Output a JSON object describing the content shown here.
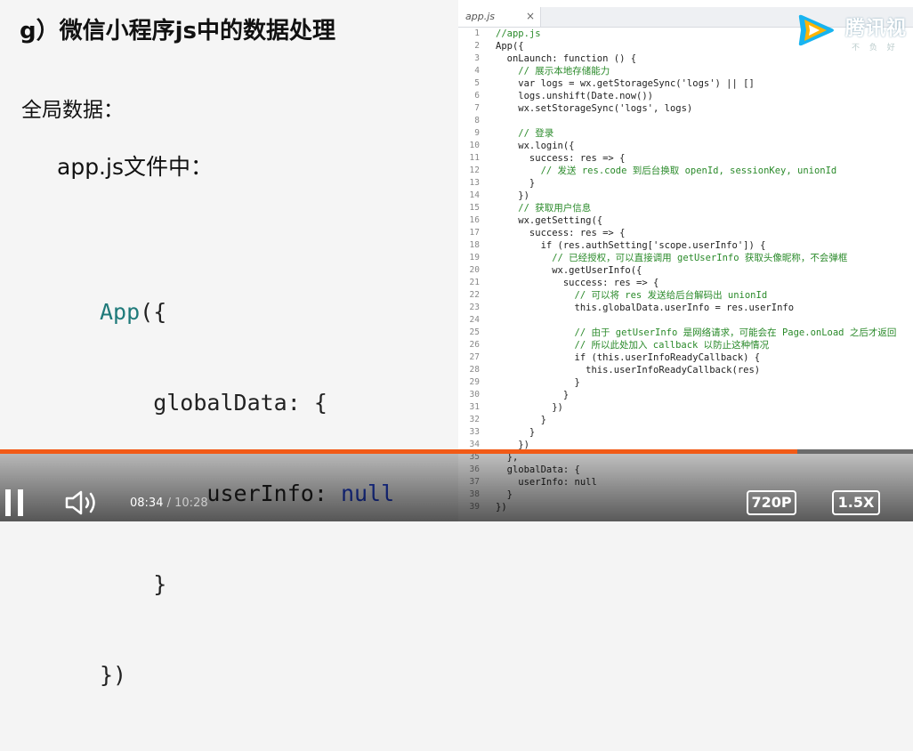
{
  "slide": {
    "title": "g）微信小程序js中的数据处理",
    "global_label": "全局数据：",
    "file_label": "app.js文件中：",
    "code_lines": [
      "App({",
      "    globalData: {",
      "        userInfo: null",
      "    }",
      "})"
    ]
  },
  "editor": {
    "tab_name": "app.js",
    "tab_close": "×",
    "lines": [
      {
        "n": "1",
        "t": "//app.js"
      },
      {
        "n": "2",
        "t": "App({"
      },
      {
        "n": "3",
        "t": "  onLaunch: function () {"
      },
      {
        "n": "4",
        "t": "    // 展示本地存储能力"
      },
      {
        "n": "5",
        "t": "    var logs = wx.getStorageSync('logs') || []"
      },
      {
        "n": "6",
        "t": "    logs.unshift(Date.now())"
      },
      {
        "n": "7",
        "t": "    wx.setStorageSync('logs', logs)"
      },
      {
        "n": "8",
        "t": ""
      },
      {
        "n": "9",
        "t": "    // 登录"
      },
      {
        "n": "10",
        "t": "    wx.login({"
      },
      {
        "n": "11",
        "t": "      success: res => {"
      },
      {
        "n": "12",
        "t": "        // 发送 res.code 到后台换取 openId, sessionKey, unionId"
      },
      {
        "n": "13",
        "t": "      }"
      },
      {
        "n": "14",
        "t": "    })"
      },
      {
        "n": "15",
        "t": "    // 获取用户信息"
      },
      {
        "n": "16",
        "t": "    wx.getSetting({"
      },
      {
        "n": "17",
        "t": "      success: res => {"
      },
      {
        "n": "18",
        "t": "        if (res.authSetting['scope.userInfo']) {"
      },
      {
        "n": "19",
        "t": "          // 已经授权，可以直接调用 getUserInfo 获取头像昵称，不会弹框"
      },
      {
        "n": "20",
        "t": "          wx.getUserInfo({"
      },
      {
        "n": "21",
        "t": "            success: res => {"
      },
      {
        "n": "22",
        "t": "              // 可以将 res 发送给后台解码出 unionId"
      },
      {
        "n": "23",
        "t": "              this.globalData.userInfo = res.userInfo"
      },
      {
        "n": "24",
        "t": ""
      },
      {
        "n": "25",
        "t": "              // 由于 getUserInfo 是网络请求，可能会在 Page.onLoad 之后才返回"
      },
      {
        "n": "26",
        "t": "              // 所以此处加入 callback 以防止这种情况"
      },
      {
        "n": "27",
        "t": "              if (this.userInfoReadyCallback) {"
      },
      {
        "n": "28",
        "t": "                this.userInfoReadyCallback(res)"
      },
      {
        "n": "29",
        "t": "              }"
      },
      {
        "n": "30",
        "t": "            }"
      },
      {
        "n": "31",
        "t": "          })"
      },
      {
        "n": "32",
        "t": "        }"
      },
      {
        "n": "33",
        "t": "      }"
      },
      {
        "n": "34",
        "t": "    })"
      },
      {
        "n": "35",
        "t": "  },"
      },
      {
        "n": "36",
        "t": "  globalData: {"
      },
      {
        "n": "37",
        "t": "    userInfo: null"
      },
      {
        "n": "38",
        "t": "  }"
      },
      {
        "n": "39",
        "t": "})"
      }
    ]
  },
  "watermark": {
    "text": "腾讯视",
    "sub": "不 负 好"
  },
  "player": {
    "progress_fraction": 0.873,
    "current_time": "08:34",
    "separator": "/",
    "duration": "10:28",
    "quality_label": "720P",
    "speed_label": "1.5X",
    "icons": {
      "play_pause": "pause-icon",
      "volume": "volume-icon"
    },
    "accent_color": "#f25a16"
  }
}
